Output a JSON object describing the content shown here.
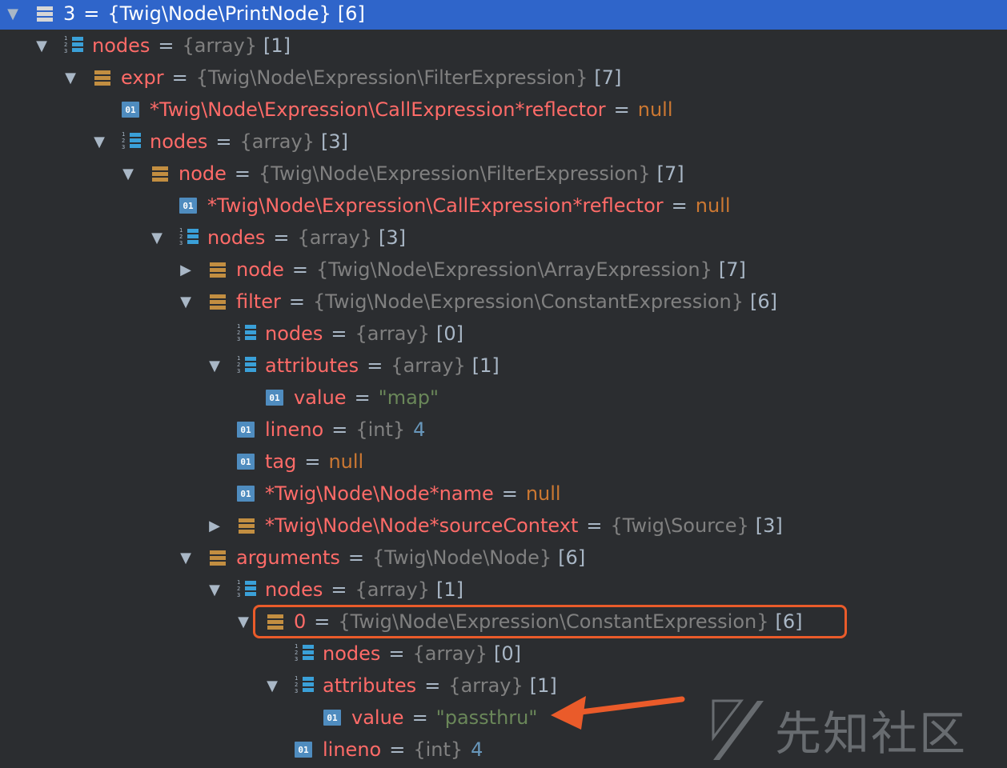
{
  "rows": [
    {
      "depth": 0,
      "toggle": "expanded",
      "icon": "object",
      "name": "3",
      "type": "{Twig\\Node\\PrintNode}",
      "count": "[6]",
      "selected": true
    },
    {
      "depth": 1,
      "toggle": "expanded",
      "icon": "array",
      "name": "nodes",
      "type": "{array}",
      "count": "[1]"
    },
    {
      "depth": 2,
      "toggle": "expanded",
      "icon": "object",
      "name": "expr",
      "type": "{Twig\\Node\\Expression\\FilterExpression}",
      "count": "[7]"
    },
    {
      "depth": 3,
      "toggle": "none",
      "icon": "primitive",
      "name": "*Twig\\Node\\Expression\\CallExpression*reflector",
      "value": "null",
      "valueKind": "null"
    },
    {
      "depth": 3,
      "toggle": "expanded",
      "icon": "array",
      "name": "nodes",
      "type": "{array}",
      "count": "[3]"
    },
    {
      "depth": 4,
      "toggle": "expanded",
      "icon": "object",
      "name": "node",
      "type": "{Twig\\Node\\Expression\\FilterExpression}",
      "count": "[7]"
    },
    {
      "depth": 5,
      "toggle": "none",
      "icon": "primitive",
      "name": "*Twig\\Node\\Expression\\CallExpression*reflector",
      "value": "null",
      "valueKind": "null"
    },
    {
      "depth": 5,
      "toggle": "expanded",
      "icon": "array",
      "name": "nodes",
      "type": "{array}",
      "count": "[3]"
    },
    {
      "depth": 6,
      "toggle": "collapsed",
      "icon": "object",
      "name": "node",
      "type": "{Twig\\Node\\Expression\\ArrayExpression}",
      "count": "[7]"
    },
    {
      "depth": 6,
      "toggle": "expanded",
      "icon": "object",
      "name": "filter",
      "type": "{Twig\\Node\\Expression\\ConstantExpression}",
      "count": "[6]"
    },
    {
      "depth": 7,
      "toggle": "none",
      "icon": "array",
      "name": "nodes",
      "type": "{array}",
      "count": "[0]"
    },
    {
      "depth": 7,
      "toggle": "expanded",
      "icon": "array",
      "name": "attributes",
      "type": "{array}",
      "count": "[1]"
    },
    {
      "depth": 8,
      "toggle": "none",
      "icon": "primitive",
      "name": "value",
      "value": "\"map\"",
      "valueKind": "string"
    },
    {
      "depth": 7,
      "toggle": "none",
      "icon": "primitive",
      "name": "lineno",
      "type": "{int}",
      "value": "4",
      "valueKind": "number"
    },
    {
      "depth": 7,
      "toggle": "none",
      "icon": "primitive",
      "name": "tag",
      "value": "null",
      "valueKind": "null"
    },
    {
      "depth": 7,
      "toggle": "none",
      "icon": "primitive",
      "name": "*Twig\\Node\\Node*name",
      "value": "null",
      "valueKind": "null"
    },
    {
      "depth": 7,
      "toggle": "collapsed",
      "icon": "object",
      "name": "*Twig\\Node\\Node*sourceContext",
      "type": "{Twig\\Source}",
      "count": "[3]"
    },
    {
      "depth": 6,
      "toggle": "expanded",
      "icon": "object",
      "name": "arguments",
      "type": "{Twig\\Node\\Node}",
      "count": "[6]"
    },
    {
      "depth": 7,
      "toggle": "expanded",
      "icon": "array",
      "name": "nodes",
      "type": "{array}",
      "count": "[1]"
    },
    {
      "depth": 8,
      "toggle": "expanded",
      "icon": "object",
      "name": "0",
      "type": "{Twig\\Node\\Expression\\ConstantExpression}",
      "count": "[6]",
      "highlighted": true
    },
    {
      "depth": 9,
      "toggle": "none",
      "icon": "array",
      "name": "nodes",
      "type": "{array}",
      "count": "[0]"
    },
    {
      "depth": 9,
      "toggle": "expanded",
      "icon": "array",
      "name": "attributes",
      "type": "{array}",
      "count": "[1]"
    },
    {
      "depth": 10,
      "toggle": "none",
      "icon": "primitive",
      "name": "value",
      "value": "\"passthru\"",
      "valueKind": "string",
      "arrowed": true
    },
    {
      "depth": 9,
      "toggle": "none",
      "icon": "primitive",
      "name": "lineno",
      "type": "{int}",
      "value": "4",
      "valueKind": "number"
    }
  ],
  "labels": {
    "equals": "=",
    "primitive_icon": "01",
    "array_icon_digits": "123"
  },
  "watermark": {
    "text": "先知社区"
  },
  "colors": {
    "selection": "#2f65ca",
    "name": "#ff6b68",
    "type": "#808080",
    "null": "#cc7832",
    "number": "#6897bb",
    "string": "#6a8759",
    "highlight_border": "#ea5b2a"
  }
}
